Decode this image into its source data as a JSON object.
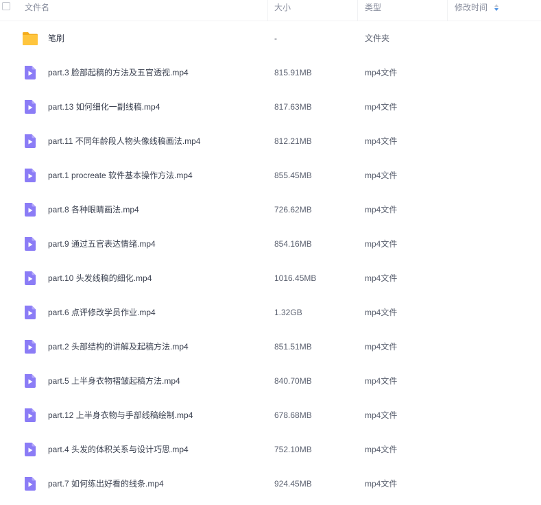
{
  "header": {
    "name_label": "文件名",
    "size_label": "大小",
    "type_label": "类型",
    "modified_label": "修改时间"
  },
  "files": [
    {
      "name": "笔刷",
      "size": "-",
      "type": "文件夹",
      "icon": "folder-icon"
    },
    {
      "name": "part.3 脸部起稿的方法及五官透视.mp4",
      "size": "815.91MB",
      "type": "mp4文件",
      "icon": "video-file-icon"
    },
    {
      "name": "part.13 如何细化一副线稿.mp4",
      "size": "817.63MB",
      "type": "mp4文件",
      "icon": "video-file-icon"
    },
    {
      "name": "part.11 不同年龄段人物头像线稿画法.mp4",
      "size": "812.21MB",
      "type": "mp4文件",
      "icon": "video-file-icon"
    },
    {
      "name": "part.1 procreate 软件基本操作方法.mp4",
      "size": "855.45MB",
      "type": "mp4文件",
      "icon": "video-file-icon"
    },
    {
      "name": "part.8 各种眼睛画法.mp4",
      "size": "726.62MB",
      "type": "mp4文件",
      "icon": "video-file-icon"
    },
    {
      "name": "part.9 通过五官表达情绪.mp4",
      "size": "854.16MB",
      "type": "mp4文件",
      "icon": "video-file-icon"
    },
    {
      "name": "part.10 头发线稿的细化.mp4",
      "size": "1016.45MB",
      "type": "mp4文件",
      "icon": "video-file-icon"
    },
    {
      "name": "part.6 点评修改学员作业.mp4",
      "size": "1.32GB",
      "type": "mp4文件",
      "icon": "video-file-icon"
    },
    {
      "name": "part.2 头部结构的讲解及起稿方法.mp4",
      "size": "851.51MB",
      "type": "mp4文件",
      "icon": "video-file-icon"
    },
    {
      "name": "part.5 上半身衣物褶皱起稿方法.mp4",
      "size": "840.70MB",
      "type": "mp4文件",
      "icon": "video-file-icon"
    },
    {
      "name": "part.12 上半身衣物与手部线稿绘制.mp4",
      "size": "678.68MB",
      "type": "mp4文件",
      "icon": "video-file-icon"
    },
    {
      "name": "part.4 头发的体积关系与设计巧思.mp4",
      "size": "752.10MB",
      "type": "mp4文件",
      "icon": "video-file-icon"
    },
    {
      "name": "part.7 如何练出好看的线条.mp4",
      "size": "924.45MB",
      "type": "mp4文件",
      "icon": "video-file-icon"
    }
  ],
  "colors": {
    "folder": "#ffc53d",
    "video_icon": "#8b7cf6",
    "sort_arrow_active": "#4a90e2"
  }
}
